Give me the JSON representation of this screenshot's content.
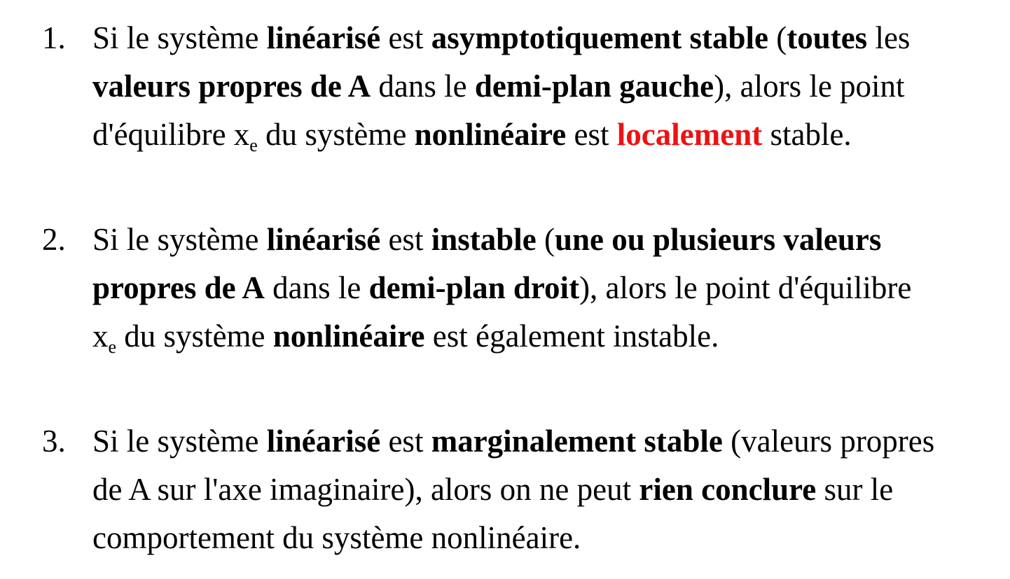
{
  "items": [
    {
      "number": "1.",
      "lines": [
        [
          {
            "t": "Si le système ",
            "s": "n"
          },
          {
            "t": "linéarisé",
            "s": "b"
          },
          {
            "t": " est ",
            "s": "n"
          },
          {
            "t": "asymptotiquement stable",
            "s": "b"
          },
          {
            "t": " (",
            "s": "n"
          },
          {
            "t": "toutes",
            "s": "b"
          },
          {
            "t": " les",
            "s": "n"
          }
        ],
        [
          {
            "t": "valeurs propres de A",
            "s": "b"
          },
          {
            "t": " dans le ",
            "s": "n"
          },
          {
            "t": "demi-plan gauche",
            "s": "b"
          },
          {
            "t": "), alors le point",
            "s": "n"
          }
        ],
        [
          {
            "t": "d'équilibre x",
            "s": "n"
          },
          {
            "t": "e",
            "s": "sub"
          },
          {
            "t": " du système ",
            "s": "n"
          },
          {
            "t": "nonlinéaire",
            "s": "b"
          },
          {
            "t": " est ",
            "s": "n"
          },
          {
            "t": "localement",
            "s": "red"
          },
          {
            "t": " stable.",
            "s": "n"
          }
        ]
      ]
    },
    {
      "number": "2.",
      "lines": [
        [
          {
            "t": "Si le système ",
            "s": "n"
          },
          {
            "t": "linéarisé",
            "s": "b"
          },
          {
            "t": " est ",
            "s": "n"
          },
          {
            "t": "instable",
            "s": "b"
          },
          {
            "t": " (",
            "s": "n"
          },
          {
            "t": "une ou plusieurs valeurs",
            "s": "b"
          }
        ],
        [
          {
            "t": "propres de A",
            "s": "b"
          },
          {
            "t": " dans le ",
            "s": "n"
          },
          {
            "t": "demi-plan droit",
            "s": "b"
          },
          {
            "t": "), alors le point d'équilibre",
            "s": "n"
          }
        ],
        [
          {
            "t": "x",
            "s": "n"
          },
          {
            "t": "e",
            "s": "sub"
          },
          {
            "t": " du système ",
            "s": "n"
          },
          {
            "t": "nonlinéaire",
            "s": "b"
          },
          {
            "t": " est également instable.",
            "s": "n"
          }
        ]
      ]
    },
    {
      "number": "3.",
      "lines": [
        [
          {
            "t": "Si le système ",
            "s": "n"
          },
          {
            "t": "linéarisé",
            "s": "b"
          },
          {
            "t": " est ",
            "s": "n"
          },
          {
            "t": "marginalement stable",
            "s": "b"
          },
          {
            "t": " (valeurs propres",
            "s": "n"
          }
        ],
        [
          {
            "t": "de A sur l'axe imaginaire), alors on ne peut ",
            "s": "n"
          },
          {
            "t": "rien conclure",
            "s": "b"
          },
          {
            "t": " sur le",
            "s": "n"
          }
        ],
        [
          {
            "t": "comportement du système nonlinéaire.",
            "s": "n"
          }
        ]
      ]
    }
  ],
  "colors": {
    "text": "#000000",
    "highlight": "#ee1111",
    "background": "#ffffff"
  }
}
